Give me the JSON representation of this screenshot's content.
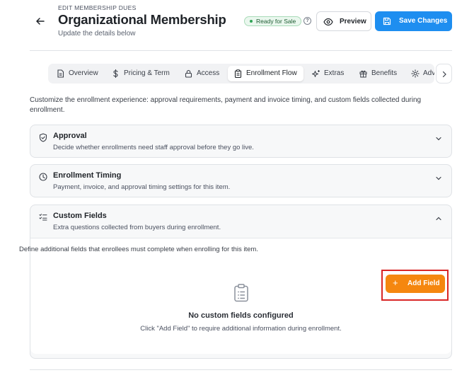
{
  "header": {
    "eyebrow": "EDIT MEMBERSHIP DUES",
    "title": "Organizational Membership",
    "subtitle": "Update the details below",
    "status": "Ready for Sale",
    "help": "?",
    "preview_label": "Preview",
    "save_label": "Save Changes"
  },
  "tabs": [
    {
      "label": "Overview",
      "icon": "document-icon"
    },
    {
      "label": "Pricing & Term",
      "icon": "dollar-icon"
    },
    {
      "label": "Access",
      "icon": "lock-icon"
    },
    {
      "label": "Enrollment Flow",
      "icon": "clipboard-icon",
      "active": true
    },
    {
      "label": "Extras",
      "icon": "sparkle-icon"
    },
    {
      "label": "Benefits",
      "icon": "gift-icon"
    },
    {
      "label": "Adv",
      "icon": "gear-icon"
    }
  ],
  "intro": "Customize the enrollment experience: approval requirements, payment and invoice timing, and custom fields collected during enrollment.",
  "sections": {
    "approval": {
      "title": "Approval",
      "desc": "Decide whether enrollments need staff approval before they go live."
    },
    "timing": {
      "title": "Enrollment Timing",
      "desc": "Payment, invoice, and approval timing settings for this item."
    },
    "custom_fields": {
      "title": "Custom Fields",
      "desc": "Extra questions collected from buyers during enrollment.",
      "note": "Define additional fields that enrollees must complete when enrolling for this item.",
      "add_label": "Add Field",
      "add_plus": "+",
      "empty_title": "No custom fields configured",
      "empty_sub": "Click \"Add Field\" to require additional information during enrollment."
    }
  },
  "colors": {
    "primary": "#1e8ef0",
    "accent_orange": "#f5870f",
    "success": "#2fa356",
    "highlight": "#d92626"
  }
}
